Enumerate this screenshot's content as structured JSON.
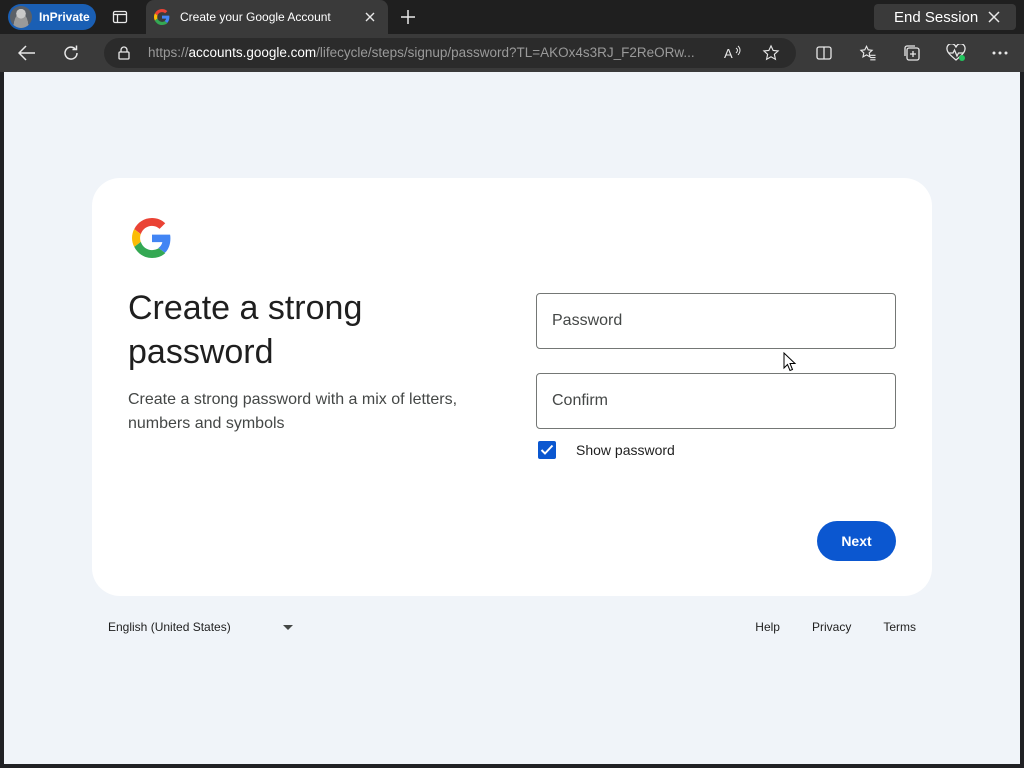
{
  "browser": {
    "inprivate_label": "InPrivate",
    "tab_title": "Create your Google Account",
    "end_session_label": "End Session",
    "url_prefix": "https://",
    "url_host": "accounts.google.com",
    "url_path": "/lifecycle/steps/signup/password?TL=AKOx4s3RJ_F2ReORw..."
  },
  "page": {
    "heading": "Create a strong password",
    "subtext": "Create a strong password with a mix of letters, numbers and symbols",
    "password_placeholder": "Password",
    "confirm_placeholder": "Confirm",
    "show_password_label": "Show password",
    "show_password_checked": true,
    "next_label": "Next"
  },
  "footer": {
    "language": "English (United States)",
    "links": [
      "Help",
      "Privacy",
      "Terms"
    ]
  },
  "colors": {
    "accent": "#0b57d0",
    "page_background": "#f0f4f9",
    "inprivate_badge": "#1a5fb4"
  }
}
